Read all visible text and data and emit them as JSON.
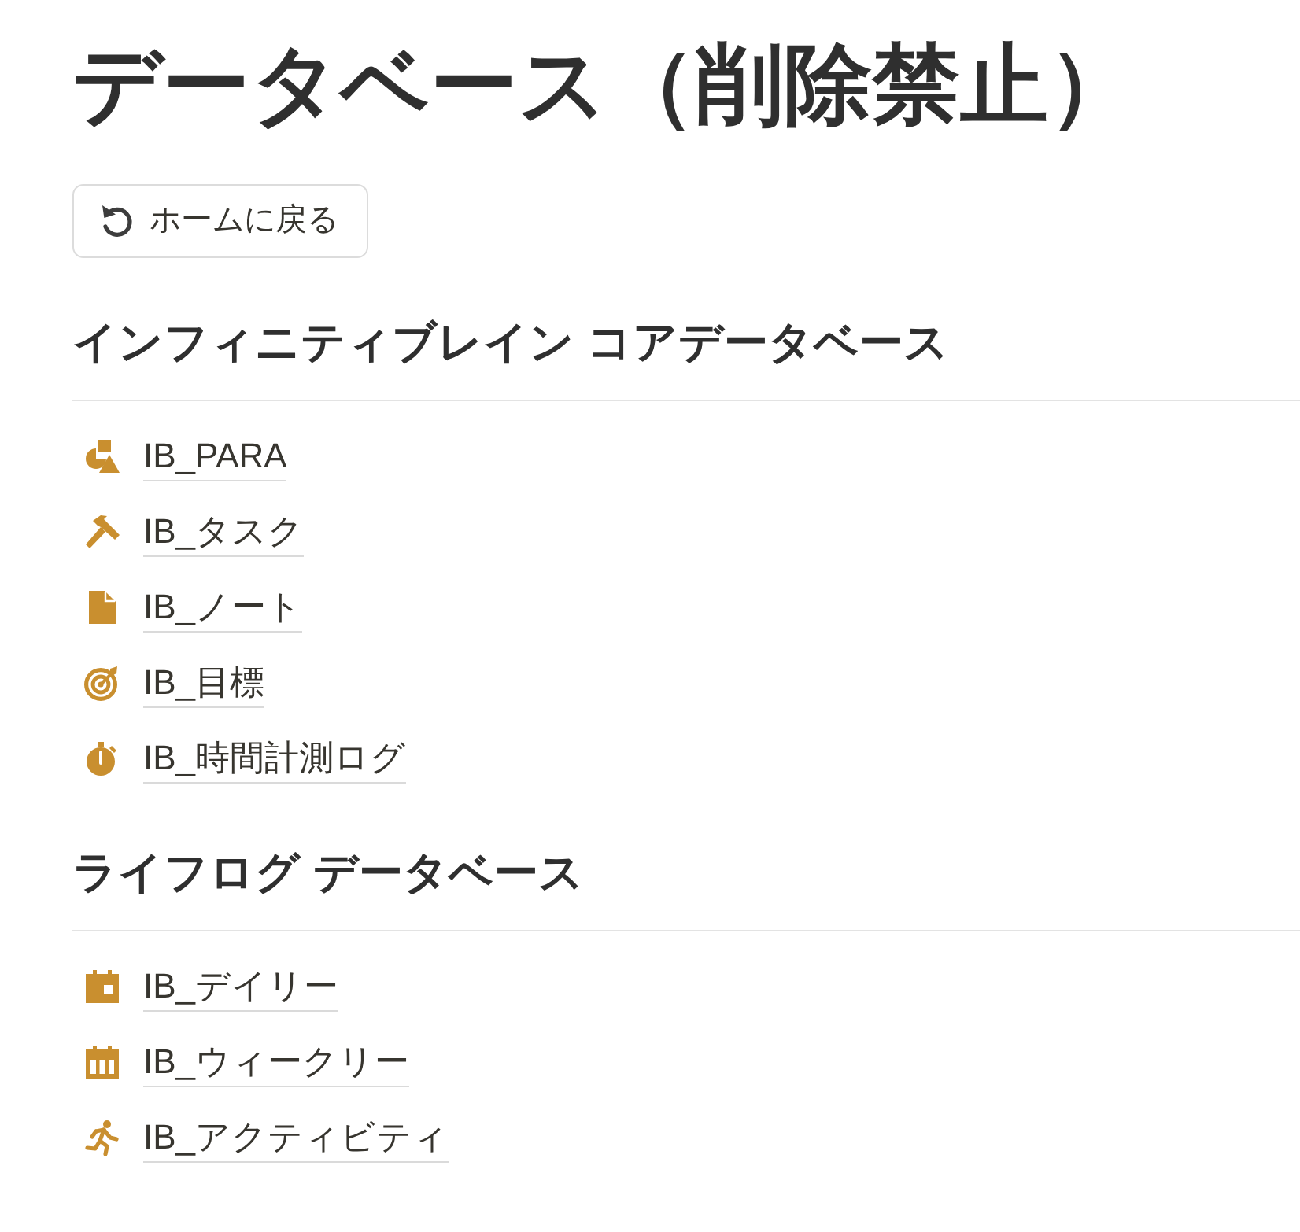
{
  "page": {
    "title": "データベース（削除禁止）"
  },
  "home_button": {
    "label": "ホームに戻る"
  },
  "sections": [
    {
      "heading": "インフィニティブレイン コアデータベース",
      "items": [
        {
          "kind": "shapes",
          "label": "IB_PARA"
        },
        {
          "kind": "hammer",
          "label": "IB_タスク"
        },
        {
          "kind": "document",
          "label": "IB_ノート"
        },
        {
          "kind": "target",
          "label": "IB_目標"
        },
        {
          "kind": "stopwatch",
          "label": "IB_時間計測ログ"
        }
      ]
    },
    {
      "heading": "ライフログ データベース",
      "items": [
        {
          "kind": "calendar_day",
          "label": "IB_デイリー"
        },
        {
          "kind": "calendar_week",
          "label": "IB_ウィークリー"
        },
        {
          "kind": "runner",
          "label": "IB_アクティビティ"
        }
      ]
    }
  ]
}
